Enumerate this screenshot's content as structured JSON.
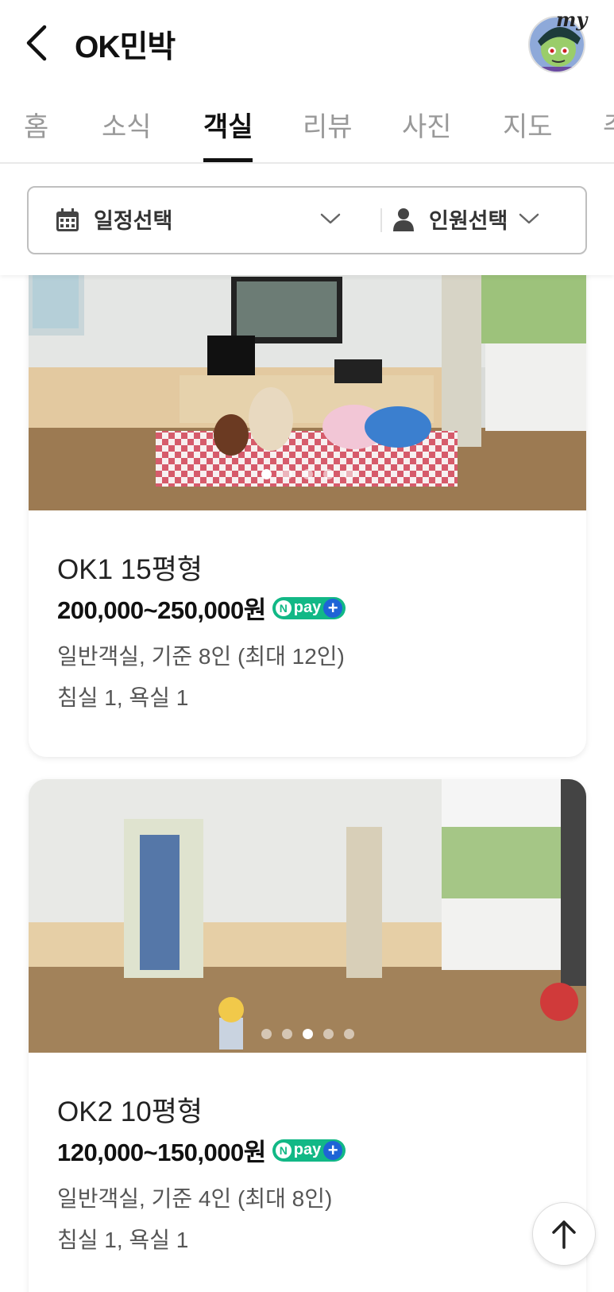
{
  "header": {
    "title": "OK민박",
    "avatar_badge": "my"
  },
  "tabs": [
    {
      "label": "홈"
    },
    {
      "label": "소식"
    },
    {
      "label": "객실",
      "active": true
    },
    {
      "label": "리뷰"
    },
    {
      "label": "사진"
    },
    {
      "label": "지도"
    },
    {
      "label": "주"
    }
  ],
  "filters": {
    "date_label": "일정선택",
    "people_label": "인원선택"
  },
  "rooms": [
    {
      "name": "OK1 15평형",
      "price": "200,000~250,000원",
      "info1": "일반객실, 기준 8인 (최대 12인)",
      "info2": "침실 1, 욕실 1",
      "photo_index": 1,
      "photo_count": 5
    },
    {
      "name": "OK2 10평형",
      "price": "120,000~150,000원",
      "info1": "일반객실, 기준 4인 (최대 8인)",
      "info2": "침실 1, 욕실 1",
      "photo_index": 3,
      "photo_count": 5
    }
  ],
  "npay_label": "pay",
  "colors": {
    "npay_green": "#12b886",
    "npay_blue": "#1e64d6"
  }
}
